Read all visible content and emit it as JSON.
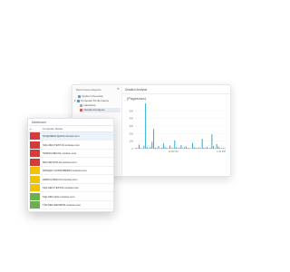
{
  "window": {
    "nav": {
      "title": "Performance Reports",
      "pin_icon": "pin-icon",
      "items": [
        {
          "label": "System Overview",
          "icon": "overview-icon",
          "icon_color": "#7f8c99"
        },
        {
          "label": "Computer Performance",
          "icon": "computer-icon",
          "icon_color": "#4a90d9"
        },
        {
          "label": "Hardware",
          "icon": "hardware-icon",
          "icon_color": "#9aa5b1"
        },
        {
          "label": "Detailed Analysis",
          "icon": "analysis-icon",
          "icon_color": "#d9534f",
          "selected": true
        }
      ]
    },
    "main": {
      "title": "Detailed Analysis",
      "chart_title": "(Pages/sec)"
    }
  },
  "chart_data": {
    "type": "bar",
    "title": "(Pages/sec)",
    "xlabel": "",
    "ylabel": "",
    "ylim": [
      0,
      600
    ],
    "yticks": [
      0,
      100,
      200,
      300,
      400,
      500
    ],
    "xticks": [
      "12:00 PM",
      "1:00 PM"
    ],
    "grid": true,
    "color": "#29a7d8",
    "values": [
      12,
      8,
      55,
      10,
      6,
      40,
      620,
      18,
      7,
      22,
      90,
      260,
      15,
      9,
      35,
      8,
      12,
      70,
      25,
      10,
      6,
      40,
      15,
      8,
      110,
      20,
      9,
      14,
      48,
      7,
      18,
      30,
      12,
      9,
      6,
      75,
      20,
      11,
      8,
      16,
      9,
      130,
      14,
      10,
      22,
      8,
      12,
      190,
      35,
      9,
      60,
      28,
      12,
      8,
      10,
      6
    ]
  },
  "dashboard": {
    "title": "Dashboard",
    "column": "Computer Name",
    "sort_icon": "sort-arrow-icon",
    "rows": [
      {
        "name": "SCQLDEV2-QA1\\0.contoso.com",
        "color": "#d63a3a",
        "highlight": true
      },
      {
        "name": "SQL-DEV-TEST-01.contoso.com",
        "color": "#d63a3a"
      },
      {
        "name": "SP2010-DEV-01.contoso.com",
        "color": "#d63a3a"
      },
      {
        "name": "DEV-SETOOL01.contoso.com",
        "color": "#d63a3a"
      },
      {
        "name": "HDNQE7-CONSUMER01.contoso.com",
        "color": "#f2c300"
      },
      {
        "name": "HDDO3-TEST-01.contoso.com",
        "color": "#f2c300"
      },
      {
        "name": "SQL-DEV-TEST01.contoso.com",
        "color": "#f2c300"
      },
      {
        "name": "SQL-DEV-QA1.contoso.com",
        "color": "#6ab04c"
      },
      {
        "name": "TSC-DEV-DEVMON.contoso.com",
        "color": "#6ab04c"
      }
    ]
  }
}
